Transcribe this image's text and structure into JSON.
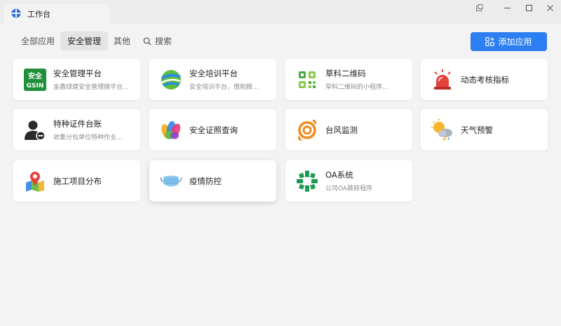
{
  "window": {
    "tab_title": "工作台"
  },
  "filters": {
    "tabs": [
      {
        "label": "全部应用"
      },
      {
        "label": "安全管理"
      },
      {
        "label": "其他"
      }
    ],
    "active_tab": "安全管理",
    "search_label": "搜索"
  },
  "add_button": {
    "label": "添加应用"
  },
  "apps": [
    {
      "title": "安全管理平台",
      "desc": "金鑫绿建安全管理微平台...",
      "icon": "gsin-logo-icon",
      "badge_line1": "安全",
      "badge_line2": "GSIN"
    },
    {
      "title": "安全培训平台",
      "desc": "安全培训平台，借助腾...",
      "icon": "globe-icon"
    },
    {
      "title": "草料二维码",
      "desc": "草料二维码的小程序...",
      "icon": "qr-code-icon"
    },
    {
      "title": "动态考核指标",
      "desc": "",
      "icon": "alarm-light-icon"
    },
    {
      "title": "特种证件台账",
      "desc": "收集分包单位特种作业...",
      "icon": "user-minus-icon"
    },
    {
      "title": "安全证照查询",
      "desc": "",
      "icon": "colorful-leaves-icon"
    },
    {
      "title": "台风监测",
      "desc": "",
      "icon": "typhoon-icon"
    },
    {
      "title": "天气预警",
      "desc": "",
      "icon": "weather-storm-icon"
    },
    {
      "title": "施工项目分布",
      "desc": "",
      "icon": "map-pin-icon"
    },
    {
      "title": "疫情防控",
      "desc": "",
      "icon": "face-mask-icon"
    },
    {
      "title": "OA系统",
      "desc": "公司OA跳转程序",
      "icon": "oa-logo-icon"
    }
  ],
  "colors": {
    "accent": "#2b7ff0",
    "background": "#f3f3f4",
    "card": "#ffffff"
  }
}
